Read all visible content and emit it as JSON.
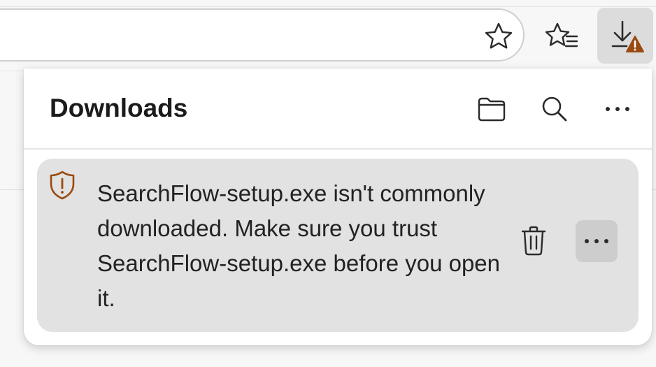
{
  "toolbar": {
    "address_bar_value": "",
    "icons": {
      "favorite": "star-icon",
      "favorites_list": "favorites-icon",
      "downloads": "download-warning-icon"
    }
  },
  "downloads_panel": {
    "title": "Downloads",
    "header_actions": [
      {
        "name": "open-folder",
        "icon": "folder-icon"
      },
      {
        "name": "search-downloads",
        "icon": "search-icon"
      },
      {
        "name": "more-options",
        "icon": "more-horizontal-icon"
      }
    ],
    "items": [
      {
        "icon": "shield-warning-icon",
        "message": "SearchFlow-setup.exe isn't commonly downloaded. Make sure you trust SearchFlow-setup.exe before you open it.",
        "actions": [
          {
            "name": "delete",
            "icon": "trash-icon"
          },
          {
            "name": "more-actions",
            "icon": "more-horizontal-icon"
          }
        ]
      }
    ]
  },
  "colors": {
    "warning_accent": "#9a4a10",
    "panel_bg": "#ffffff",
    "item_bg": "#e2e2e2",
    "active_button_bg": "#dcdcdc"
  }
}
